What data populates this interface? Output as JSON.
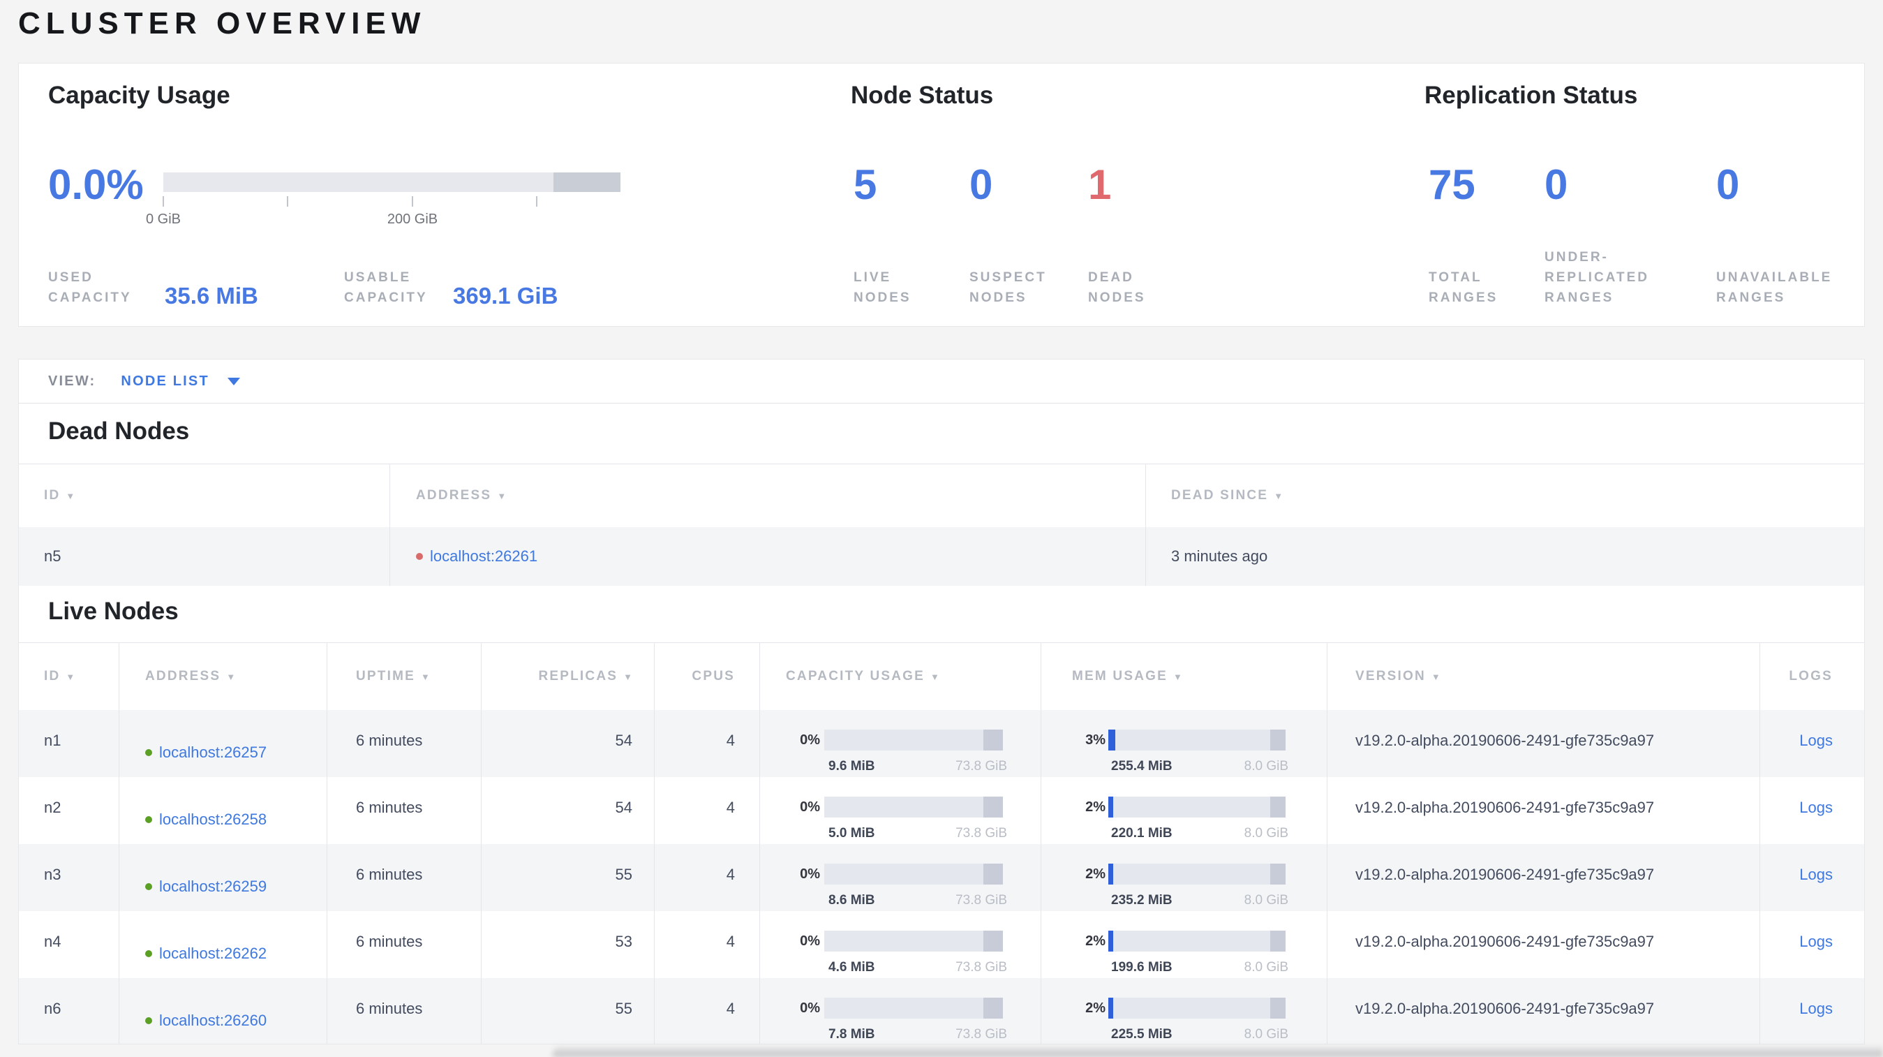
{
  "page_title": "CLUSTER OVERVIEW",
  "colors": {
    "accent_blue": "#3e78e0",
    "value_blue": "#4879e2",
    "dead_red": "#e0696e",
    "live_dot_green": "#5ba024",
    "dead_dot_red": "#d96b6b"
  },
  "overview": {
    "capacity": {
      "title": "Capacity Usage",
      "percent": "0.0%",
      "axis_tick_labels": [
        "0 GiB",
        "200 GiB"
      ],
      "stats": [
        {
          "label_lines": [
            "USED",
            "CAPACITY"
          ],
          "value": "35.6 MiB"
        },
        {
          "label_lines": [
            "USABLE",
            "CAPACITY"
          ],
          "value": "369.1 GiB"
        }
      ]
    },
    "node_status": {
      "title": "Node Status",
      "stats": [
        {
          "value": "5",
          "label_lines": [
            "LIVE",
            "NODES"
          ],
          "tone": "blue"
        },
        {
          "value": "0",
          "label_lines": [
            "SUSPECT",
            "NODES"
          ],
          "tone": "blue"
        },
        {
          "value": "1",
          "label_lines": [
            "DEAD",
            "NODES"
          ],
          "tone": "red"
        }
      ]
    },
    "replication": {
      "title": "Replication Status",
      "stats": [
        {
          "value": "75",
          "label_lines": [
            "TOTAL",
            "RANGES"
          ],
          "tone": "blue"
        },
        {
          "value": "0",
          "label_lines": [
            "UNDER-",
            "REPLICATED",
            "RANGES"
          ],
          "tone": "blue"
        },
        {
          "value": "0",
          "label_lines": [
            "UNAVAILABLE",
            "RANGES"
          ],
          "tone": "blue"
        }
      ]
    }
  },
  "view_bar": {
    "label": "VIEW:",
    "selected": "NODE LIST"
  },
  "dead_nodes": {
    "title": "Dead Nodes",
    "columns": [
      {
        "label": "ID",
        "sortable": true
      },
      {
        "label": "ADDRESS",
        "sortable": true
      },
      {
        "label": "DEAD SINCE",
        "sortable": true
      }
    ],
    "rows": [
      {
        "id": "n5",
        "address": "localhost:26261",
        "dead_since": "3 minutes ago"
      }
    ]
  },
  "live_nodes": {
    "title": "Live Nodes",
    "columns": [
      {
        "label": "ID",
        "sortable": true
      },
      {
        "label": "ADDRESS",
        "sortable": true
      },
      {
        "label": "UPTIME",
        "sortable": true
      },
      {
        "label": "REPLICAS",
        "sortable": true
      },
      {
        "label": "CPUS",
        "sortable": false
      },
      {
        "label": "CAPACITY USAGE",
        "sortable": true
      },
      {
        "label": "MEM USAGE",
        "sortable": true
      },
      {
        "label": "VERSION",
        "sortable": true
      },
      {
        "label": "LOGS",
        "sortable": false
      }
    ],
    "rows": [
      {
        "id": "n1",
        "address": "localhost:26257",
        "uptime": "6 minutes",
        "replicas": "54",
        "cpus": "4",
        "capacity": {
          "percent": "0%",
          "percent_num": 0,
          "used": "9.6 MiB",
          "total": "73.8 GiB"
        },
        "memory": {
          "percent": "3%",
          "percent_num": 3,
          "used": "255.4 MiB",
          "total": "8.0 GiB"
        },
        "version": "v19.2.0-alpha.20190606-2491-gfe735c9a97",
        "logs": "Logs"
      },
      {
        "id": "n2",
        "address": "localhost:26258",
        "uptime": "6 minutes",
        "replicas": "54",
        "cpus": "4",
        "capacity": {
          "percent": "0%",
          "percent_num": 0,
          "used": "5.0 MiB",
          "total": "73.8 GiB"
        },
        "memory": {
          "percent": "2%",
          "percent_num": 2,
          "used": "220.1 MiB",
          "total": "8.0 GiB"
        },
        "version": "v19.2.0-alpha.20190606-2491-gfe735c9a97",
        "logs": "Logs"
      },
      {
        "id": "n3",
        "address": "localhost:26259",
        "uptime": "6 minutes",
        "replicas": "55",
        "cpus": "4",
        "capacity": {
          "percent": "0%",
          "percent_num": 0,
          "used": "8.6 MiB",
          "total": "73.8 GiB"
        },
        "memory": {
          "percent": "2%",
          "percent_num": 2,
          "used": "235.2 MiB",
          "total": "8.0 GiB"
        },
        "version": "v19.2.0-alpha.20190606-2491-gfe735c9a97",
        "logs": "Logs"
      },
      {
        "id": "n4",
        "address": "localhost:26262",
        "uptime": "6 minutes",
        "replicas": "53",
        "cpus": "4",
        "capacity": {
          "percent": "0%",
          "percent_num": 0,
          "used": "4.6 MiB",
          "total": "73.8 GiB"
        },
        "memory": {
          "percent": "2%",
          "percent_num": 2,
          "used": "199.6 MiB",
          "total": "8.0 GiB"
        },
        "version": "v19.2.0-alpha.20190606-2491-gfe735c9a97",
        "logs": "Logs"
      },
      {
        "id": "n6",
        "address": "localhost:26260",
        "uptime": "6 minutes",
        "replicas": "55",
        "cpus": "4",
        "capacity": {
          "percent": "0%",
          "percent_num": 0,
          "used": "7.8 MiB",
          "total": "73.8 GiB"
        },
        "memory": {
          "percent": "2%",
          "percent_num": 2,
          "used": "225.5 MiB",
          "total": "8.0 GiB"
        },
        "version": "v19.2.0-alpha.20190606-2491-gfe735c9a97",
        "logs": "Logs"
      }
    ]
  }
}
